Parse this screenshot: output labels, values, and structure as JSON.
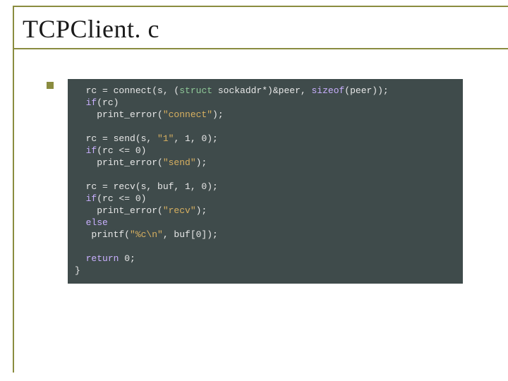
{
  "slide": {
    "title": "TCPClient. c"
  },
  "code": {
    "l1a": "  rc = connect(s, (",
    "l1b": "struct",
    "l1c": " sockaddr*)&peer, ",
    "l1d": "sizeof",
    "l1e": "(peer));",
    "l2a": "  ",
    "l2b": "if",
    "l2c": "(rc)",
    "l3a": "    print_error(",
    "l3b": "\"connect\"",
    "l3c": ");",
    "l5a": "  rc = send(s, ",
    "l5b": "\"1\"",
    "l5c": ", 1, 0);",
    "l6a": "  ",
    "l6b": "if",
    "l6c": "(rc <= 0)",
    "l7a": "    print_error(",
    "l7b": "\"send\"",
    "l7c": ");",
    "l9a": "  rc = recv(s, buf, 1, 0);",
    "l10a": "  ",
    "l10b": "if",
    "l10c": "(rc <= 0)",
    "l11a": "    print_error(",
    "l11b": "\"recv\"",
    "l11c": ");",
    "l12a": "  ",
    "l12b": "else",
    "l13a": "   printf(",
    "l13b": "\"%c\\n\"",
    "l13c": ", buf[0]);",
    "l15a": "  ",
    "l15b": "return",
    "l15c": " 0;",
    "l16": "}"
  }
}
